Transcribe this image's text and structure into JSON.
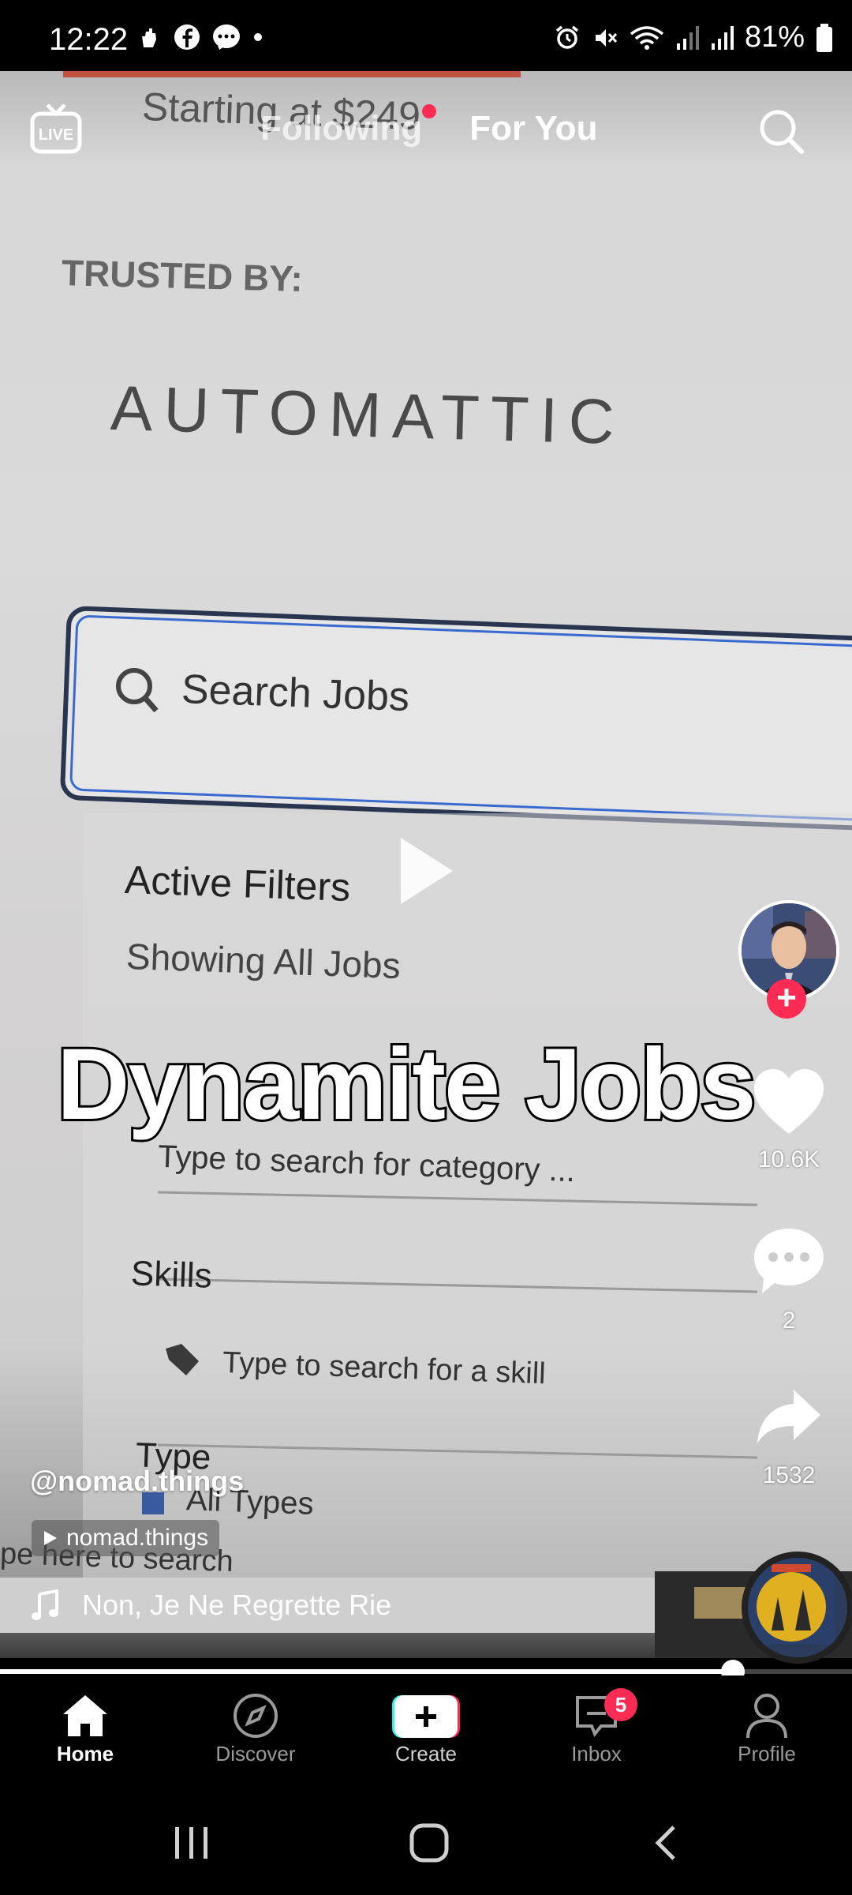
{
  "status_bar": {
    "time": "12:22",
    "battery": "81%",
    "icons": [
      "hand-icon",
      "facebook-icon",
      "messenger-icon",
      "dot-icon",
      "alarm-icon",
      "mute-icon",
      "wifi-icon",
      "signal-icon",
      "signal-icon",
      "battery-icon"
    ]
  },
  "top_nav": {
    "live_label": "LIVE",
    "tab_following": "Following",
    "tab_for_you": "For You"
  },
  "video_content": {
    "price_text": "Starting at $249",
    "trusted_by": "TRUSTED BY:",
    "logo_text": "AUTOMATTIC",
    "search_placeholder": "Search Jobs",
    "active_filters": "Active Filters",
    "showing": "Showing All Jobs",
    "category_placeholder": "Type to search for category ...",
    "skills_label": "Skills",
    "skill_placeholder": "Type to search for a skill",
    "type_label": "Type",
    "all_types": "All Types",
    "bottom_search": "pe here to search"
  },
  "overlay": {
    "caption": "Dynamite Jobs",
    "username": "@nomad.things",
    "source_chip": "nomad.things",
    "music": "Non, Je Ne Regrette Rie"
  },
  "right_rail": {
    "likes": "10.6K",
    "comments": "2",
    "shares": "1532"
  },
  "progress": {
    "played_fraction": 0.86
  },
  "bottom_nav": {
    "home": "Home",
    "discover": "Discover",
    "create": "Create",
    "inbox": "Inbox",
    "inbox_badge": "5",
    "profile": "Profile"
  },
  "colors": {
    "accent": "#fe2c55",
    "create_cyan": "#25f4ee"
  }
}
